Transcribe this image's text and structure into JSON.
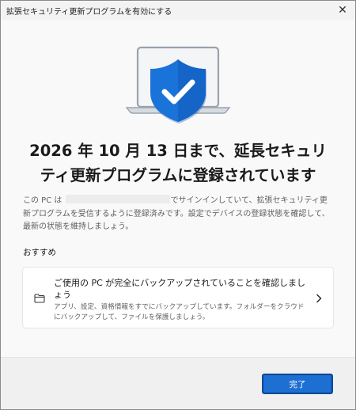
{
  "window": {
    "title": "拡張セキュリティ更新プログラムを有効にする",
    "close_glyph": "✕"
  },
  "hero": {
    "icon": "laptop-with-shield-check-icon",
    "accent_color": "#1a73d9"
  },
  "main": {
    "headline": "2026 年 10 月 13 日まで、延長セキュリティ更新プログラムに登録されています",
    "body_prefix": "この PC は",
    "body_suffix": "でサインインしていて、拡張セキュリティ更新プログラムを受信するように登録済みです。設定でデバイスの登録状態を確認して、最新の状態を維持しましょう。",
    "section_label": "おすすめ"
  },
  "recommendation": {
    "title": "ご使用の PC が完全にバックアップされていることを確認しましょう",
    "description": "アプリ、設定、資格情報をすでにバックアップしています。フォルダーをクラウドにバックアップして、ファイルを保護しましょう。",
    "icon": "folder-icon"
  },
  "footer": {
    "done_label": "完了",
    "button_color": "#1d6fd1"
  }
}
